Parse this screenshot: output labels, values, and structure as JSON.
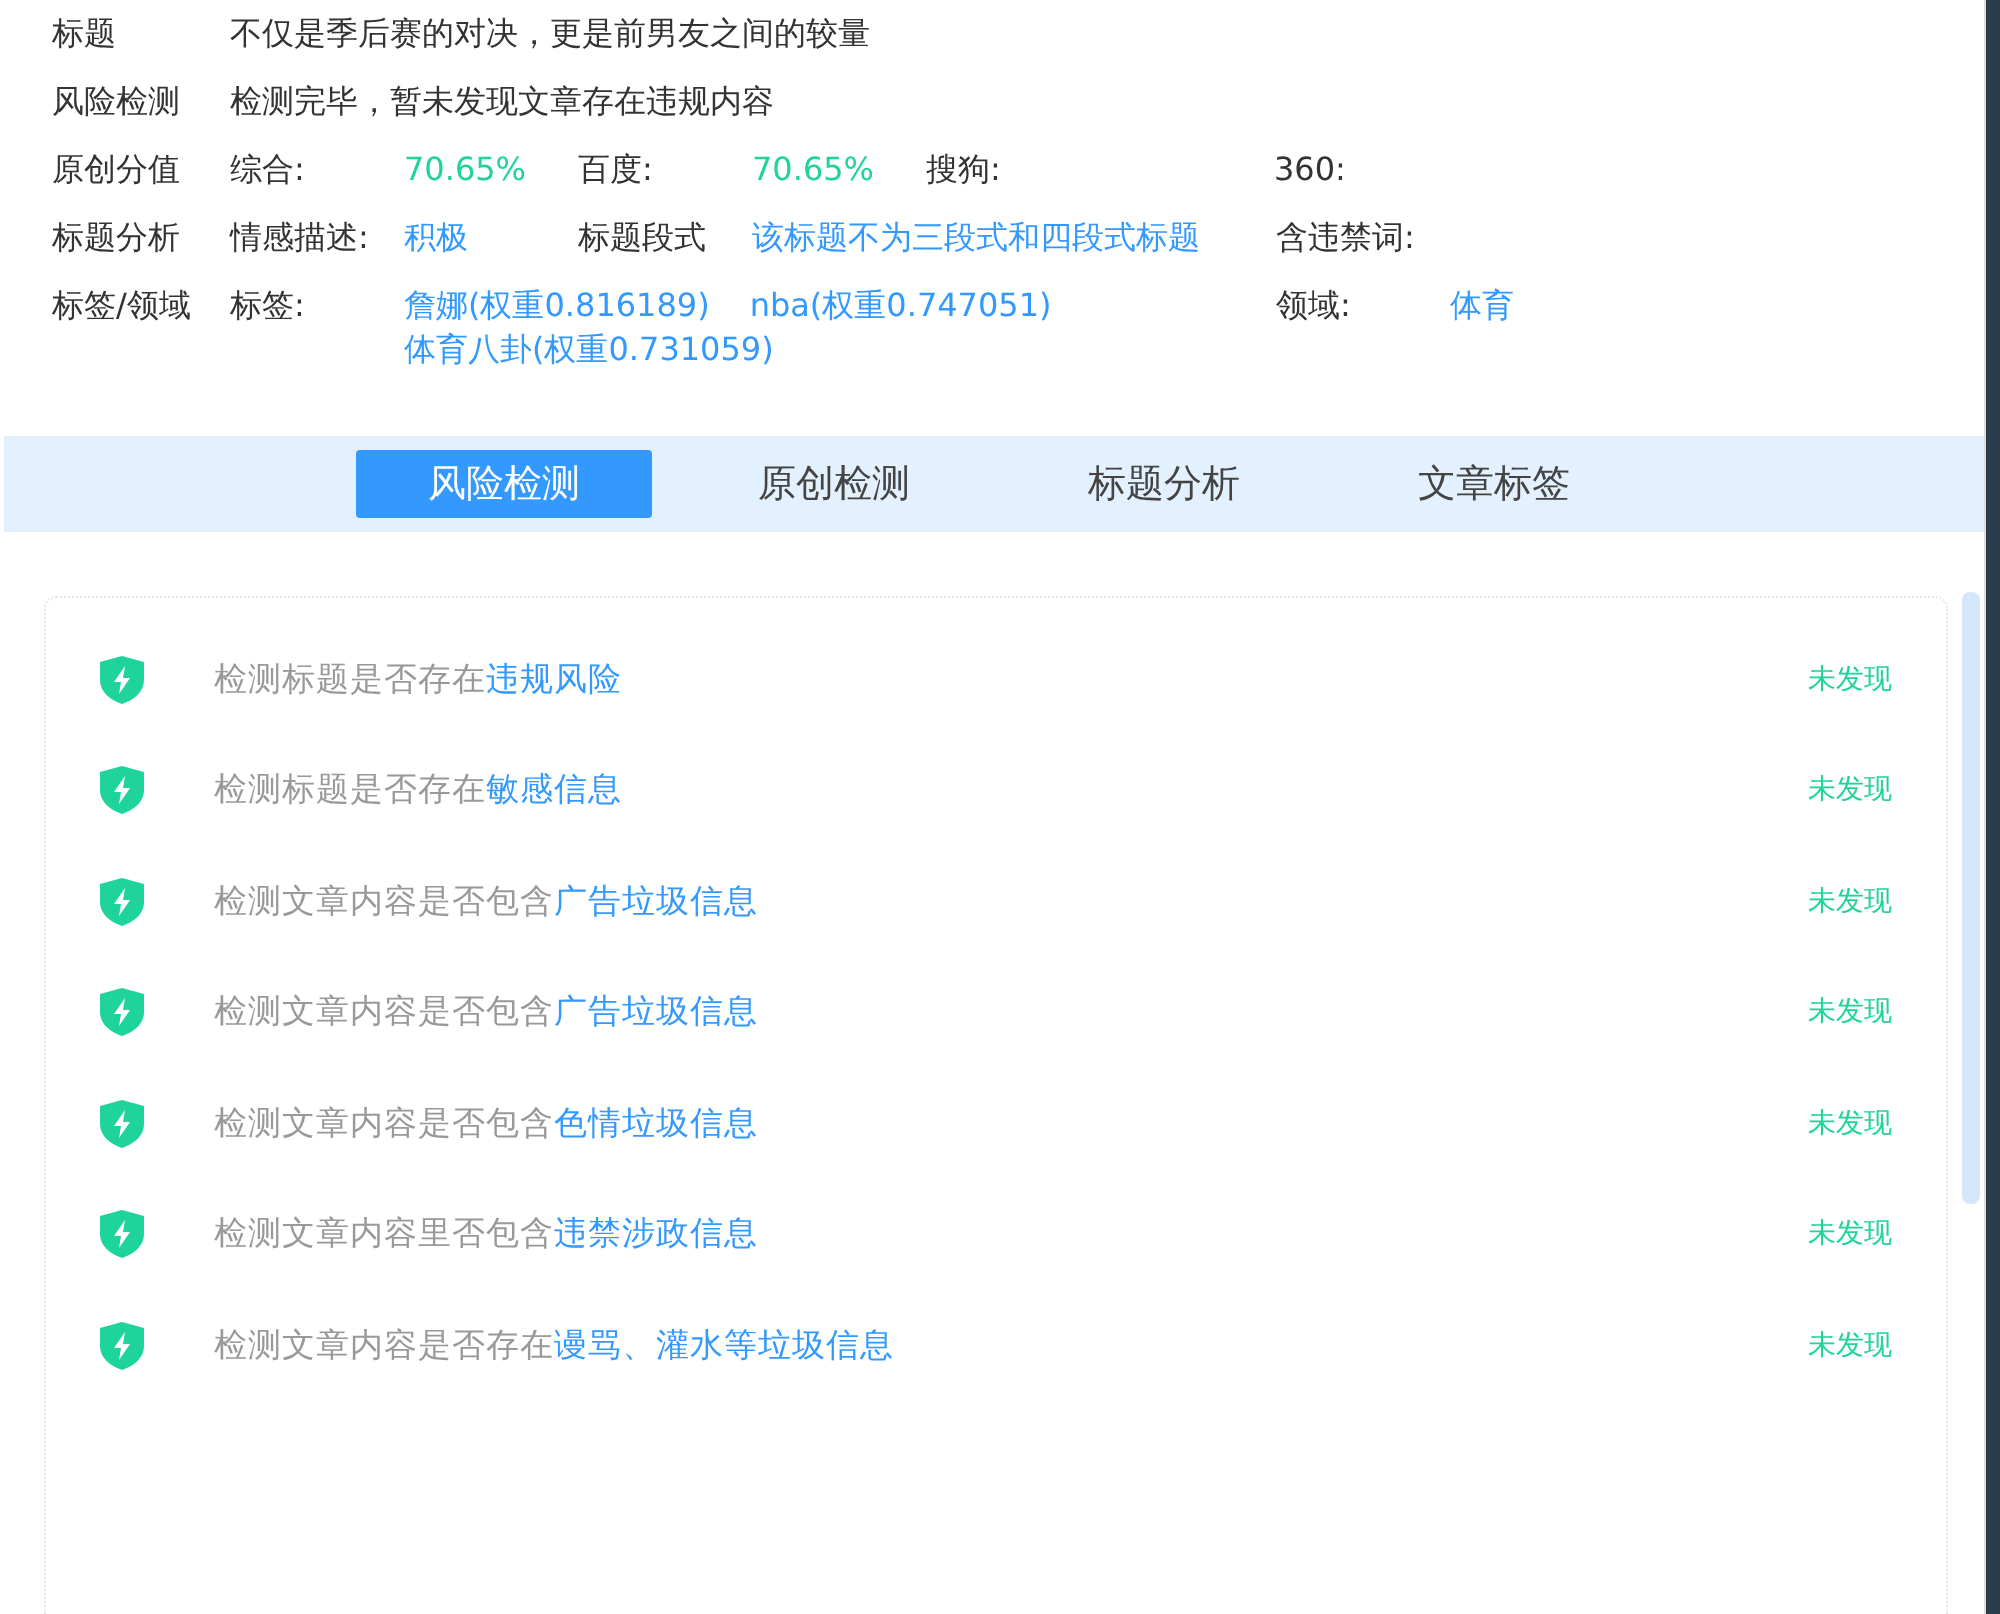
{
  "info": [
    {
      "kind": "text",
      "label": "标题",
      "text": "不仅是季后赛的对决，更是前男友之间的较量"
    },
    {
      "kind": "text",
      "label": "风险检测",
      "text": "检测完毕，暂未发现文章存在违规内容"
    },
    {
      "kind": "scores",
      "label": "原创分值",
      "items": [
        {
          "name": "综合:",
          "value": "70.65%"
        },
        {
          "name": "百度:",
          "value": "70.65%"
        },
        {
          "name": "搜狗:"
        },
        {
          "name": "360:"
        }
      ]
    },
    {
      "kind": "analysis",
      "label": "标题分析",
      "items": [
        {
          "name": "情感描述:",
          "value": "积极"
        },
        {
          "name": "标题段式",
          "value": "该标题不为三段式和四段式标题"
        },
        {
          "name": "含违禁词:"
        }
      ]
    },
    {
      "kind": "tags",
      "label": "标签/领域",
      "tags_label": "标签:",
      "tags": [
        "詹娜(权重0.816189)",
        "nba(权重0.747051)",
        "体育八卦(权重0.731059)"
      ],
      "domain_label": "领域:",
      "domain": "体育"
    }
  ],
  "tabs": [
    {
      "label": "风险检测",
      "selected": true
    },
    {
      "label": "原创检测",
      "selected": false
    },
    {
      "label": "标题分析",
      "selected": false
    },
    {
      "label": "文章标签",
      "selected": false
    }
  ],
  "checks": [
    {
      "prefix": "检测标题是否存在",
      "highlight": "违规风险",
      "status": "未发现"
    },
    {
      "prefix": "检测标题是否存在",
      "highlight": "敏感信息",
      "status": "未发现"
    },
    {
      "prefix": "检测文章内容是否包含",
      "highlight": "广告垃圾信息",
      "status": "未发现"
    },
    {
      "prefix": "检测文章内容是否包含",
      "highlight": "广告垃圾信息",
      "status": "未发现"
    },
    {
      "prefix": "检测文章内容是否包含",
      "highlight": "色情垃圾信息",
      "status": "未发现"
    },
    {
      "prefix": "检测文章内容里否包含",
      "highlight": "违禁涉政信息",
      "status": "未发现"
    },
    {
      "prefix": "检测文章内容是否存在",
      "highlight": "谩骂、灌水等垃圾信息",
      "status": "未发现"
    }
  ]
}
